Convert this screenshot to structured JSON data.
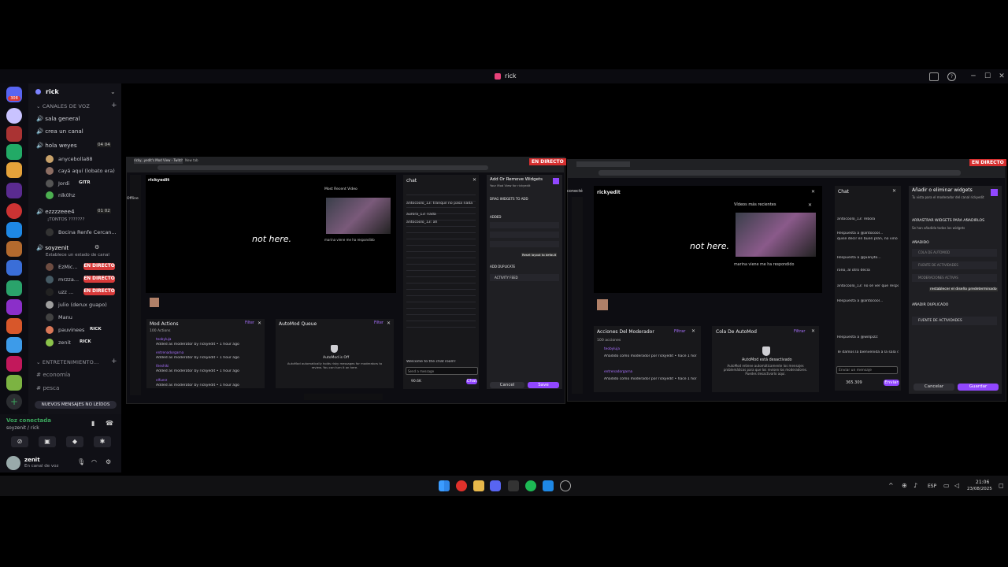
{
  "window": {
    "title": "rick"
  },
  "sidebar": {
    "server_name": "rick",
    "categories": {
      "voice": "CANALES DE VOZ",
      "entertainment": "ENTRETENIMIENTO..."
    },
    "channels": [
      {
        "name": "sala general"
      },
      {
        "name": "crea un canal"
      },
      {
        "name": "hola weyes",
        "count": "04",
        "max": "04"
      },
      {
        "name": "ezzzzeee4",
        "count": "01",
        "max": "02"
      },
      {
        "name": "soyzenit"
      },
      {
        "name": "economía"
      },
      {
        "name": "pesca"
      }
    ],
    "users_hola": [
      "anycebolla88",
      "cayá aquí (lobato era)",
      "Jordi",
      "nlk0hz"
    ],
    "user_jordi_tag": "GITR",
    "ezzz_status": "¡TONTOS ???????",
    "ezzz_user": "Bocina Renfe Cercan...",
    "soyzenit_status": "Establece un estado de canal",
    "users_soyzenit": [
      {
        "name": "EzMic...",
        "live": "EN DIRECTO"
      },
      {
        "name": "mrzza...",
        "live": "EN DIRECTO"
      },
      {
        "name": "uzz ...",
        "live": "EN DIRECTO"
      },
      {
        "name": "julio (derux guapo)",
        "live": ""
      },
      {
        "name": "Manu",
        "live": ""
      },
      {
        "name": "pauvinees",
        "live": "",
        "tag": "RICK"
      },
      {
        "name": "zenit",
        "live": "",
        "tag": "RICK"
      }
    ],
    "new_messages": "NUEVOS MENSAJES NO LEÍDOS"
  },
  "voice": {
    "status": "Voz conectada",
    "channel": "soyzenit / rick",
    "user": "zenit",
    "user_status": "En canal de voz"
  },
  "stream_left": {
    "live": "EN DIRECTO",
    "tabs": [
      "ricky...yedit's Mod View - Twitch",
      "New tab"
    ],
    "channel": "rickyedit",
    "offline": "Offline",
    "video_text": "not here.",
    "most_recent": "Most Recent Video",
    "caption": "marina viene me ha respondido",
    "chat_title": "chat",
    "mod_actions": "Mod Actions",
    "mod_actions_count": "100 Actions",
    "automod": "AutoMod Queue",
    "automod_off": "AutoMod is Off",
    "automod_desc": "AutoMod automatically holds risky messages for moderators to review. You can turn it on here.",
    "filter": "Filter",
    "widgets_title": "Add Or Remove Widgets",
    "widgets_sub": "Your Mod View for rickyedit",
    "drag_label": "DRAG WIDGETS TO ADD",
    "added": "ADDED",
    "added_dup": "ADD DUPLICATE",
    "activity_feed": "ACTIVITY FEED",
    "reset": "Reset layout to default",
    "cancel": "Cancel",
    "save": "Save",
    "send_placeholder": "Send a message",
    "chat_btn": "Chat",
    "points": "90.6K",
    "mod_entries": [
      {
        "user": "teobyluja",
        "text": "Added as moderator by rickyedit • 1 hour ago"
      },
      {
        "user": "entrenadorgarna",
        "text": "Added as moderator by rickyedit • 1 hour ago"
      },
      {
        "user": "theshiki",
        "text": "Added as moderator by rickyedit • 1 hour ago"
      },
      {
        "user": "elfuerz",
        "text": "Added as moderator by rickyedit • 1 hour ago"
      }
    ],
    "chat_lines": [
      "antocoolo_13: tranquil no pasa nada",
      "aurora_13: nada",
      "antocoolo_13: ah",
      "Welcome to the chat room!"
    ]
  },
  "stream_right": {
    "live": "EN DIRECTO",
    "channel": "rickyedit",
    "connect": "conecté",
    "video_text": "not here.",
    "most_recent": "Vídeos más recientes",
    "caption": "marina viene me ha respondido",
    "chat_title": "Chat",
    "mod_actions": "Acciones Del Moderador",
    "mod_actions_count": "100 acciones",
    "automod": "Cola De AutoMod",
    "automod_off": "AutoMod está desactivado",
    "automod_desc": "AutoMod retiene automáticamente los mensajes problemáticos para que los revisen los moderadores. Puedes desactivarlo aquí.",
    "filter": "Filtrar",
    "widgets_title": "Añadir o eliminar widgets",
    "widgets_sub": "Tu vista para el moderador del canal rickyedit",
    "drag_label": "ARRASTRAR WIDGETS PARA AÑADIRLOS",
    "drag_sub": "Se han añadido todos los widgets",
    "added": "AÑADIDO",
    "added_items": [
      "COLA DE AUTOMOD",
      "FUENTE DE ACTIVIDADES",
      "MODERACIONES ACTIVAS"
    ],
    "added_dup": "AÑADIR DUPLICADO",
    "activity_feed": "FUENTE DE ACTIVIDADES",
    "reset": "restablecer el diseño predeterminado",
    "cancel": "Cancelar",
    "save": "Guardar",
    "send_placeholder": "Enviar un mensaje",
    "send_btn": "Enviar",
    "points": "365.309",
    "mod_entries": [
      {
        "user": "teobyluja",
        "text": "Añadido como moderador por rickyedit • hace 1 hora"
      },
      {
        "user": "entrenadorgarna",
        "text": "Añadido como moderador por rickyedit • hace 1 hora"
      }
    ],
    "chat_lines": [
      "antocoolo_13: rebola",
      "Respuesta a @antocool...",
      "quise decir en buen plan, no vino a males",
      "Respuesta a @Juanjito...",
      "rono, al otro decía",
      "antocoolo_13: no sé ver que respondía quien no era",
      "Respuesta a @antocool...",
      "Respuesta a @willpizz: ",
      "Te damos la bienvenida a la sala de chat"
    ]
  },
  "taskbar": {
    "lang": "ESP",
    "time": "21:06",
    "date": "23/08/2025"
  },
  "colors": {
    "live": "#d62f2f",
    "accent": "#9147ff",
    "discord_live": "#d83a3a"
  }
}
